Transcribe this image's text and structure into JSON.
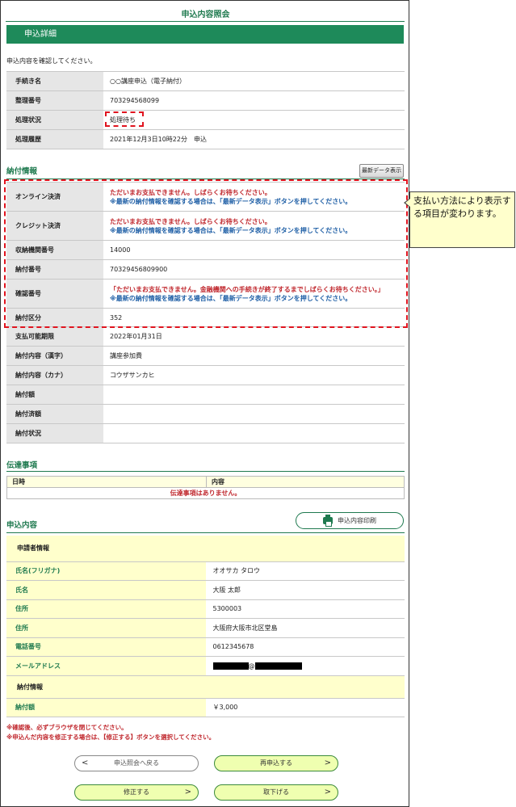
{
  "page": {
    "title": "申込内容照会",
    "section_band": "申込詳細",
    "intro": "申込内容を確認してください。"
  },
  "application": {
    "rows": [
      {
        "label": "手続き名",
        "value": "○○講座申込（電子納付）"
      },
      {
        "label": "整理番号",
        "value": "703294568099"
      },
      {
        "label": "処理状況",
        "value": "処理待ち"
      },
      {
        "label": "処理履歴",
        "value": "2021年12月3日10時22分　申込"
      }
    ]
  },
  "payment": {
    "title": "納付情報",
    "latest_button": "最新データ表示",
    "msg_wait": "ただいまお支払できません。しばらくお待ちください。",
    "msg_latest": "※最新の納付情報を確認する場合は、「最新データ表示」ボタンを押してください。",
    "msg_bank": "「ただいまお支払できません。金融機関への手続きが終了するまでしばらくお待ちください。」",
    "rows": [
      {
        "label": "オンライン決済"
      },
      {
        "label": "クレジット決済"
      },
      {
        "label": "収納機関番号",
        "value": "14000"
      },
      {
        "label": "納付番号",
        "value": "70329456809900"
      },
      {
        "label": "確認番号"
      },
      {
        "label": "納付区分",
        "value": "352"
      },
      {
        "label": "支払可能期限",
        "value": "2022年01月31日"
      },
      {
        "label": "納付内容（漢字）",
        "value": "講座参加費"
      },
      {
        "label": "納付内容（カナ）",
        "value": "コウザサンカヒ"
      },
      {
        "label": "納付額",
        "value": ""
      },
      {
        "label": "納付済額",
        "value": ""
      },
      {
        "label": "納付状況",
        "value": ""
      }
    ]
  },
  "callout": {
    "text": "支払い方法により表示する項目が変わります。"
  },
  "dentatsu": {
    "title": "伝達事項",
    "col_date": "日時",
    "col_content": "内容",
    "empty": "伝達事項はありません。"
  },
  "content": {
    "title": "申込内容",
    "print_button": "申込内容印刷",
    "applicant_head": "申請者情報",
    "applicant_rows": [
      {
        "label": "氏名(フリガナ)",
        "value": "オオサカ タロウ"
      },
      {
        "label": "氏名",
        "value": "大阪 太郎"
      },
      {
        "label": "住所",
        "value": "5300003"
      },
      {
        "label": "住所",
        "value": "大阪府大阪市北区堂島"
      },
      {
        "label": "電話番号",
        "value": "0612345678"
      },
      {
        "label": "メールアドレス",
        "value": "@"
      }
    ],
    "payment_head": "納付情報",
    "payment_rows": [
      {
        "label": "納付額",
        "value": "￥3,000"
      }
    ]
  },
  "notes": {
    "note1": "※確認後、必ずブラウザを閉じてください。",
    "note2": "※申込んだ内容を修正する場合は、【修正する】ボタンを選択してください。"
  },
  "buttons": {
    "back": "申込照会へ戻る",
    "reapply": "再申込する",
    "modify": "修正する",
    "withdraw": "取下げる",
    "arrow_left": "<",
    "arrow_right": ">"
  },
  "colors": {
    "brand_green": "#1e8a5a",
    "alert_red": "#c0272d",
    "info_blue": "#1f5fa6",
    "highlight_yellow": "#ffffcc"
  }
}
